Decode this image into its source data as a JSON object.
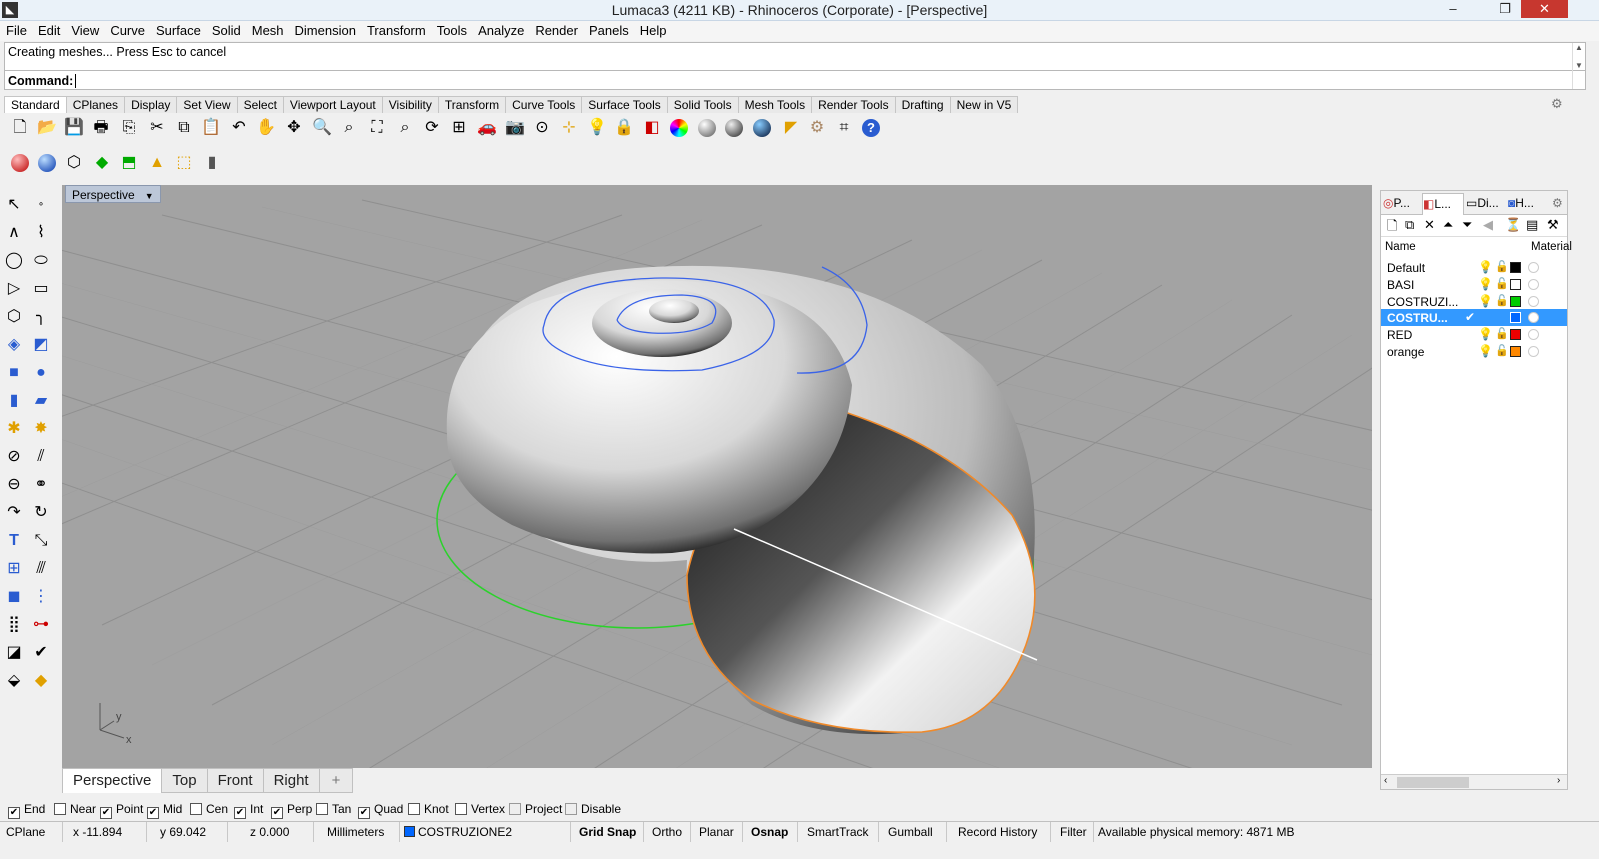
{
  "window": {
    "title": "Lumaca3 (4211 KB) - Rhinoceros (Corporate) - [Perspective]"
  },
  "menu": [
    "File",
    "Edit",
    "View",
    "Curve",
    "Surface",
    "Solid",
    "Mesh",
    "Dimension",
    "Transform",
    "Tools",
    "Analyze",
    "Render",
    "Panels",
    "Help"
  ],
  "command": {
    "history": "Creating meshes... Press Esc to cancel",
    "prompt": "Command:",
    "value": ""
  },
  "toolbar_tabs": [
    "Standard",
    "CPlanes",
    "Display",
    "Set View",
    "Select",
    "Viewport Layout",
    "Visibility",
    "Transform",
    "Curve Tools",
    "Surface Tools",
    "Solid Tools",
    "Mesh Tools",
    "Render Tools",
    "Drafting",
    "New in V5"
  ],
  "toolbar_icons": [
    "new-icon",
    "open-icon",
    "save-icon",
    "print-icon",
    "import-icon",
    "cut-icon",
    "copy-icon",
    "paste-icon",
    "undo-icon",
    "pan-icon",
    "move-view-icon",
    "zoom-icon",
    "zoom-window-icon",
    "zoom-extents-icon",
    "zoom-selected-icon",
    "rotate-view-icon",
    "viewports-icon",
    "car-icon",
    "camera-icon",
    "point-icon",
    "cplane-icon",
    "light-icon",
    "lock-icon",
    "layer-icon",
    "color-wheel-icon",
    "render-sphere-icon",
    "material-sphere-icon",
    "shaded-sphere-icon",
    "gumball-icon",
    "options-icon",
    "snap-icon",
    "help-icon"
  ],
  "toolbar2_icons": [
    "red-sphere-icon",
    "blue-sphere-icon",
    "wire-cube-icon",
    "green-gem-icon",
    "trimmed-box-icon",
    "cone-icon",
    "bounding-box-icon",
    "cylinder-icon"
  ],
  "left_tools": [
    "select-arrow-icon",
    "point-icon",
    "polyline-icon",
    "curve-icon",
    "circle-icon",
    "ellipse-icon",
    "arc-icon",
    "rectangle-icon",
    "polygon-icon",
    "fillet-icon",
    "surface-icon",
    "loft-icon",
    "box-icon",
    "sphere-icon",
    "cylinder-icon",
    "plane-icon",
    "gear-icon",
    "explode-icon",
    "boolean-icon",
    "split-icon",
    "trim-icon",
    "extend-icon",
    "text-icon",
    "dimension-icon",
    "group-icon",
    "transform-icon",
    "solid-icon",
    "array-icon",
    "grid-icon",
    "mirror-icon",
    "analyze-icon",
    "check-icon",
    "mesh-icon",
    "render-icon"
  ],
  "viewport": {
    "title": "Perspective",
    "axis_x": "x",
    "axis_y": "y"
  },
  "view_tabs": [
    "Perspective",
    "Top",
    "Front",
    "Right"
  ],
  "add_tab": "+",
  "panel": {
    "tabs": [
      "P...",
      "L...",
      "Di...",
      "H..."
    ],
    "col_name": "Name",
    "col_material": "Material",
    "layers": [
      {
        "name": "Default",
        "color": "#000000",
        "current": false,
        "selected": false
      },
      {
        "name": "BASI",
        "color": "#ffffff",
        "current": false,
        "selected": false
      },
      {
        "name": "COSTRUZI...",
        "color": "#00cc00",
        "current": false,
        "selected": false
      },
      {
        "name": "COSTRU...",
        "color": "#0066ff",
        "current": true,
        "selected": true
      },
      {
        "name": "RED",
        "color": "#ee0000",
        "current": false,
        "selected": false
      },
      {
        "name": "orange",
        "color": "#ff8800",
        "current": false,
        "selected": false
      }
    ]
  },
  "osnaps": [
    {
      "label": "End",
      "checked": true
    },
    {
      "label": "Near",
      "checked": false
    },
    {
      "label": "Point",
      "checked": true
    },
    {
      "label": "Mid",
      "checked": true
    },
    {
      "label": "Cen",
      "checked": false
    },
    {
      "label": "Int",
      "checked": true
    },
    {
      "label": "Perp",
      "checked": true
    },
    {
      "label": "Tan",
      "checked": false
    },
    {
      "label": "Quad",
      "checked": true
    },
    {
      "label": "Knot",
      "checked": false
    },
    {
      "label": "Vertex",
      "checked": false
    },
    {
      "label": "Project",
      "checked": false
    },
    {
      "label": "Disable",
      "checked": false
    }
  ],
  "status": {
    "cplane": "CPlane",
    "x": "x -11.894",
    "y": "y 69.042",
    "z": "z 0.000",
    "units": "Millimeters",
    "layer": "COSTRUZIONE2",
    "layer_color": "#0066ff",
    "grid_snap": "Grid Snap",
    "ortho": "Ortho",
    "planar": "Planar",
    "osnap": "Osnap",
    "smarttrack": "SmartTrack",
    "gumball": "Gumball",
    "record_history": "Record History",
    "filter": "Filter",
    "memory": "Available physical memory: 4871 MB"
  }
}
